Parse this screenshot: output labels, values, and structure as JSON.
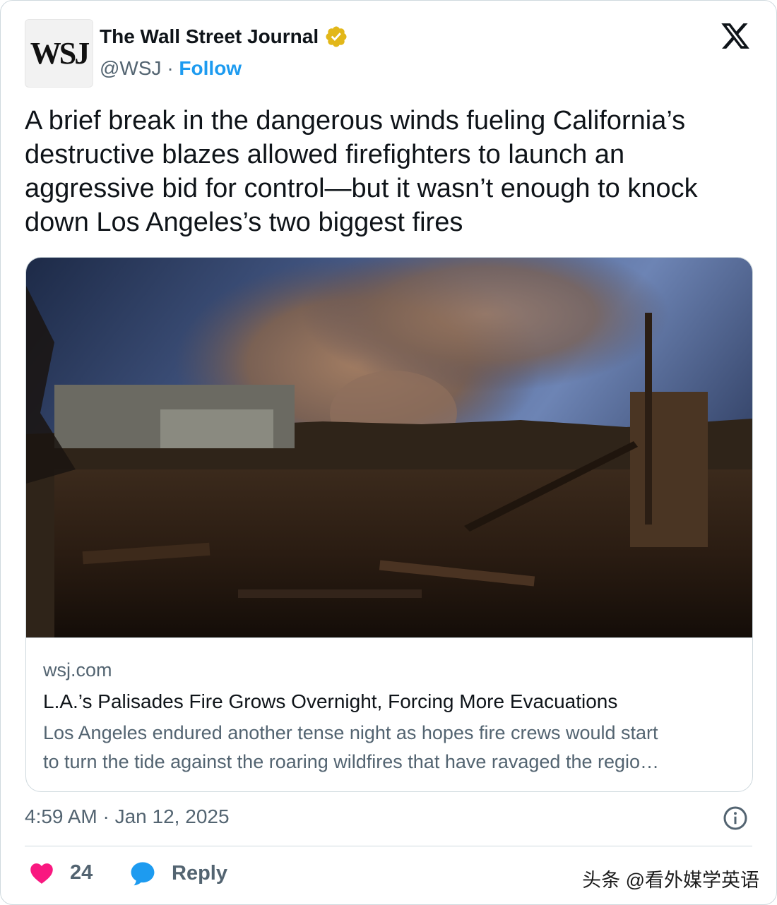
{
  "author": {
    "avatar_text": "WSJ",
    "name": "The Wall Street Journal",
    "handle": "@WSJ",
    "separator": "·",
    "follow_label": "Follow"
  },
  "tweet": {
    "text": "A brief break in the dangerous winds fueling California’s destructive blazes allowed firefighters to launch an aggressive bid for control—but it wasn’t enough to knock down Los Angeles’s two biggest fires"
  },
  "link_card": {
    "domain": "wsj.com",
    "title": "L.A.’s Palisades Fire Grows Overnight, Forcing More Evacuations",
    "description_line1": "Los Angeles endured another tense night as hopes fire crews would start",
    "description_line2": "to turn the tide against the roaring wildfires that have ravaged the regio…"
  },
  "meta": {
    "timestamp": "4:59 AM · Jan 12, 2025"
  },
  "actions": {
    "like_count": "24",
    "reply_label": "Reply"
  },
  "watermark": "头条 @看外媒学英语",
  "colors": {
    "accent": "#1d9bf0",
    "like": "#f91880",
    "verified": "#e2b719",
    "secondary_text": "#536471"
  },
  "icons": [
    "verified-badge-icon",
    "x-logo-icon",
    "info-icon",
    "heart-icon",
    "reply-bubble-icon"
  ]
}
